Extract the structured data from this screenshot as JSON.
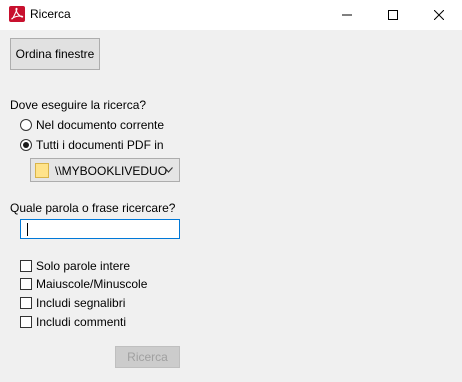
{
  "window": {
    "title": "Ricerca",
    "app_icon": "acrobat-icon",
    "controls": [
      "minimize-icon",
      "maximize-icon",
      "close-icon"
    ]
  },
  "toolbar": {
    "arrange_windows_label": "Ordina finestre"
  },
  "where": {
    "label": "Dove eseguire la ricerca?",
    "option_current": "Nel documento corrente",
    "option_all": "Tutti i documenti PDF in",
    "selected": "option_all",
    "location_value": "\\\\MYBOOKLIVEDUO",
    "location_icon": "folder-icon"
  },
  "query": {
    "label": "Quale parola o frase ricercare?",
    "value": ""
  },
  "options": {
    "whole_words": "Solo parole intere",
    "match_case": "Maiuscole/Minuscole",
    "include_bookmarks": "Includi segnalibri",
    "include_comments": "Includi commenti"
  },
  "actions": {
    "search_label": "Ricerca",
    "search_enabled": false
  },
  "colors": {
    "background": "#f0f0f0",
    "titlebar": "#ffffff",
    "focus_border": "#0078d7",
    "disabled_text": "#a0a0a0",
    "acrobat_red": "#c8102e"
  }
}
